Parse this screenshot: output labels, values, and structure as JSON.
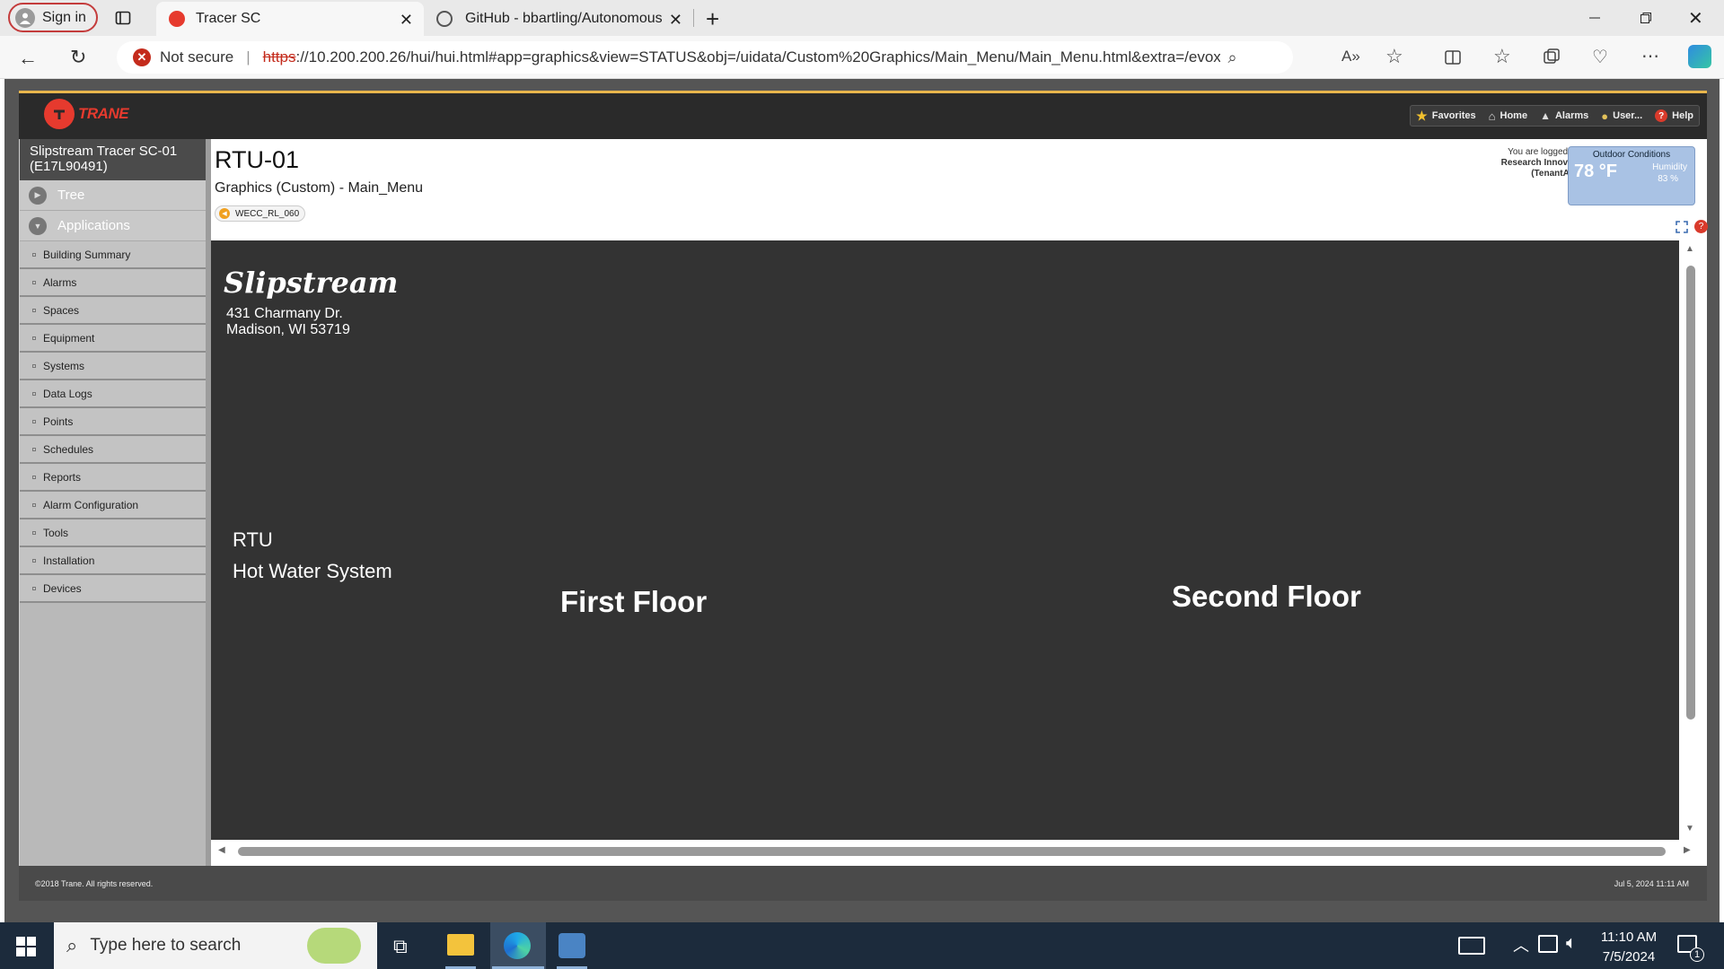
{
  "browser": {
    "profile_label": "Sign in",
    "tabs": [
      {
        "title": "Tracer SC"
      },
      {
        "title": "GitHub - bbartling/Autonomous"
      }
    ],
    "security_label": "Not secure",
    "url_scheme": "https",
    "url_rest": "://10.200.200.26/hui/hui.html#app=graphics&view=STATUS&obj=/uidata/Custom%20Graphics/Main_Menu/Main_Menu.html&extra=/evox/..."
  },
  "app": {
    "logo_text": "TRANE",
    "nav": [
      {
        "label": "Favorites"
      },
      {
        "label": "Home"
      },
      {
        "label": "Alarms"
      },
      {
        "label": "User..."
      },
      {
        "label": "Help"
      }
    ],
    "sidebar": {
      "title_line1": "Slipstream Tracer SC-01",
      "title_line2": "(E17L90491)",
      "tree_label": "Tree",
      "applications_label": "Applications",
      "items": [
        {
          "label": "Building Summary"
        },
        {
          "label": "Alarms"
        },
        {
          "label": "Spaces"
        },
        {
          "label": "Equipment"
        },
        {
          "label": "Systems"
        },
        {
          "label": "Data Logs"
        },
        {
          "label": "Points"
        },
        {
          "label": "Schedules"
        },
        {
          "label": "Reports"
        },
        {
          "label": "Alarm Configuration"
        },
        {
          "label": "Tools"
        },
        {
          "label": "Installation"
        },
        {
          "label": "Devices"
        }
      ]
    },
    "page": {
      "title": "RTU-01",
      "subtitle": "Graphics (Custom) - Main_Menu",
      "back_chip": "WECC_RL_060",
      "login_line1": "You are logged in as",
      "login_line2": "Research Innovation",
      "login_line3": "(TenantAud!t)",
      "outdoor_title": "Outdoor Conditions",
      "outdoor_temp": "78 °F",
      "humidity_label": "Humidity",
      "humidity_value": "83 %"
    },
    "graphic": {
      "brand": "Slipstream",
      "address1": "431 Charmany Dr.",
      "address2": "Madison, WI 53719",
      "link_rtu": "RTU",
      "link_hws": "Hot Water System",
      "link_first": "First Floor",
      "link_second": "Second Floor"
    },
    "footer": {
      "copyright": "©2018 Trane. All rights reserved.",
      "datetime": "Jul 5, 2024 11:11 AM"
    }
  },
  "taskbar": {
    "search_placeholder": "Type here to search",
    "time": "11:10 AM",
    "date": "7/5/2024",
    "notif_count": "1"
  },
  "colors": {
    "trane_red": "#e63a2e",
    "accent_yellow": "#e8b64c",
    "graphic_bg": "#333333"
  }
}
